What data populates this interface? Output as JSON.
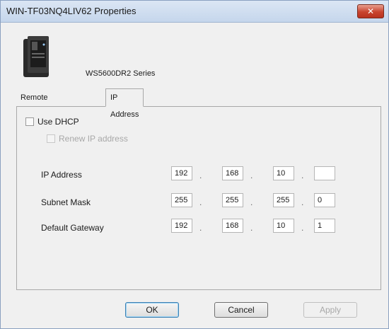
{
  "window": {
    "title": "WIN-TF03NQ4LIV62 Properties"
  },
  "device": {
    "series": "WS5600DR2 Series"
  },
  "tabs": [
    "Remote Desktop",
    "IP Address"
  ],
  "dhcp": {
    "use_label": "Use DHCP",
    "renew_label": "Renew IP address"
  },
  "fields": [
    {
      "label": "IP Address",
      "octets": [
        "192",
        "168",
        "10",
        ""
      ]
    },
    {
      "label": "Subnet Mask",
      "octets": [
        "255",
        "255",
        "255",
        "0"
      ]
    },
    {
      "label": "Default Gateway",
      "octets": [
        "192",
        "168",
        "10",
        "1"
      ]
    }
  ],
  "buttons": {
    "ok": "OK",
    "cancel": "Cancel",
    "apply": "Apply"
  },
  "separator": "."
}
